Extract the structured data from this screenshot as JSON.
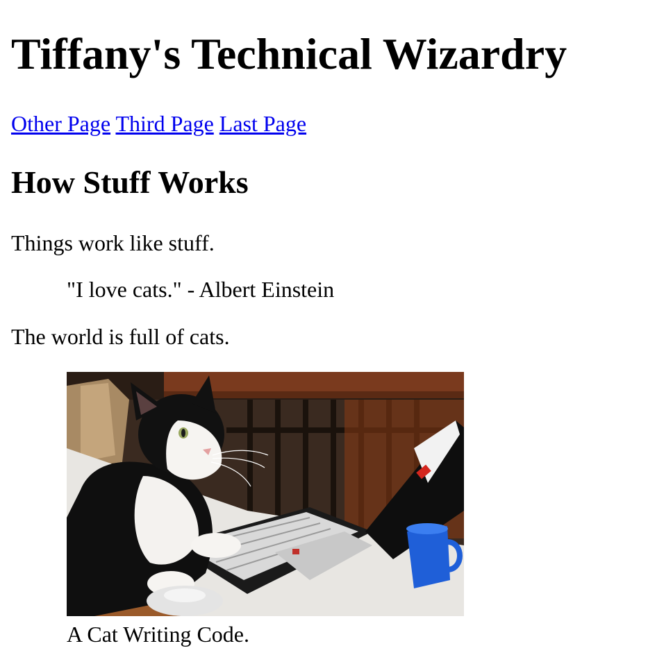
{
  "page": {
    "title": "Tiffany's Technical Wizardry",
    "nav_links": [
      "Other Page",
      "Third Page",
      "Last Page"
    ],
    "section_heading": "How Stuff Works",
    "paragraph_1": "Things work like stuff.",
    "quote": "\"I love cats.\" - Albert Einstein",
    "paragraph_2": "The world is full of cats.",
    "figure": {
      "image_subject": "black-and-white cat at a laptop with a computer mouse",
      "caption": "A Cat Writing Code."
    }
  },
  "colors": {
    "link": "#0000ee",
    "text": "#000000",
    "background": "#ffffff"
  }
}
